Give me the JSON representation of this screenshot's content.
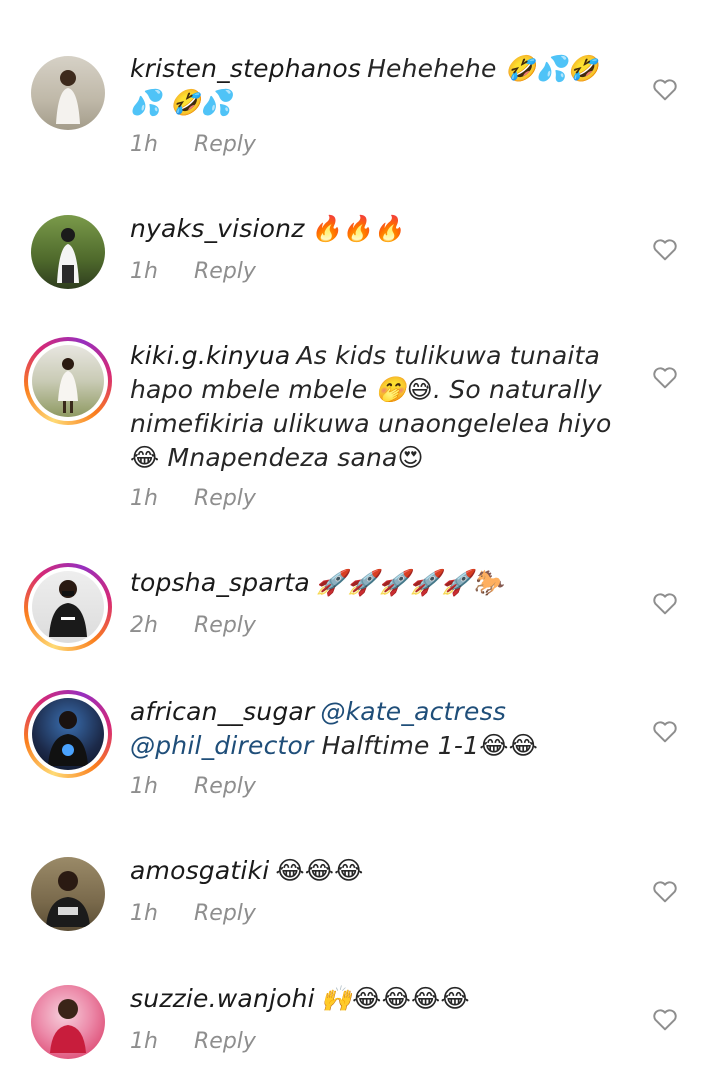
{
  "reply_label": "Reply",
  "comments": [
    {
      "username": "kristen_stephanos",
      "text": "Hehehehe 🤣💦🤣💦 🤣💦",
      "time": "1h",
      "story_ring": false,
      "avatar_colors": [
        "#c9c2b4",
        "#8a8372",
        "#3d2a1c"
      ]
    },
    {
      "username": "nyaks_visionz",
      "text": "🔥🔥🔥",
      "time": "1h",
      "story_ring": false,
      "avatar_colors": [
        "#5f7a3a",
        "#2e3d1e",
        "#1b1b1b"
      ]
    },
    {
      "username": "kiki.g.kinyua",
      "text": "As kids tulikuwa tunaita hapo mbele mbele 🤭😅. So naturally nimefikiria ulikuwa unaongelelea hiyo 😂 Mnapendeza sana😍",
      "time": "1h",
      "story_ring": true,
      "avatar_colors": [
        "#d9d6cf",
        "#9aa06e",
        "#f2f0ec"
      ]
    },
    {
      "username": "topsha_sparta",
      "text": "🚀🚀🚀🚀🚀🐎",
      "time": "2h",
      "story_ring": true,
      "avatar_colors": [
        "#e8e8e8",
        "#cfcfcf",
        "#1a1a1a"
      ]
    },
    {
      "username": "african__sugar",
      "mentions": [
        "@kate_actress",
        "@phil_director"
      ],
      "text": "Halftime 1-1😂😂",
      "time": "1h",
      "story_ring": true,
      "avatar_colors": [
        "#1c2a4a",
        "#3a6fb0",
        "#111111"
      ]
    },
    {
      "username": "amosgatiki",
      "text": "😂😂😂",
      "time": "1h",
      "story_ring": false,
      "avatar_colors": [
        "#8a7a5a",
        "#6b5a3c",
        "#222222"
      ]
    },
    {
      "username": "suzzie.wanjohi",
      "text": "🙌😂😂😂😂",
      "time": "1h",
      "story_ring": false,
      "avatar_colors": [
        "#f1b7c9",
        "#e23b6b",
        "#c81d3c"
      ]
    }
  ]
}
